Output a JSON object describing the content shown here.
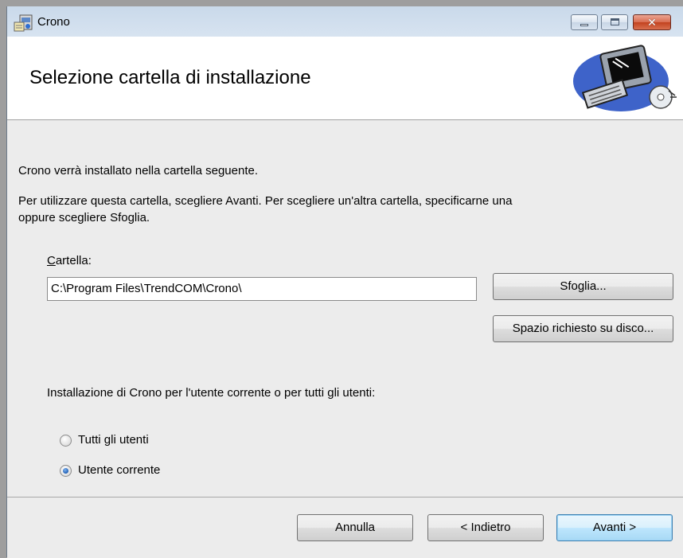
{
  "window": {
    "title": "Crono"
  },
  "header": {
    "title": "Selezione cartella di installazione",
    "graphic": "computer-install-illustration"
  },
  "body": {
    "intro": "Crono verrà installato nella cartella seguente.",
    "instructions_line1": "Per utilizzare questa cartella, scegliere Avanti. Per scegliere un'altra cartella, specificarne una",
    "instructions_line2": "oppure scegliere Sfoglia.",
    "folder_label_accel": "C",
    "folder_label_rest": "artella:",
    "folder_value": "C:\\Program Files\\TrendCOM\\Crono\\",
    "browse_button": "Sfoglia...",
    "disk_space_button": "Spazio richiesto su disco...",
    "scope_question": "Installazione di Crono per l'utente corrente o per tutti gli utenti:",
    "options": [
      {
        "label": "Tutti gli utenti",
        "checked": false
      },
      {
        "label": "Utente corrente",
        "checked": true
      }
    ]
  },
  "footer": {
    "cancel": "Annulla",
    "back": "< Indietro",
    "next": "Avanti >"
  },
  "colors": {
    "title_bar": "#c9d9ea",
    "close_button": "#c2421f",
    "default_button": "#a7d9f5"
  }
}
